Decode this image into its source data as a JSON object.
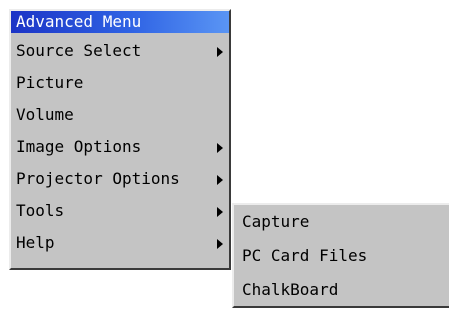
{
  "main_menu": {
    "title": "Advanced Menu",
    "items": [
      {
        "label": "Source Select",
        "has_submenu": true
      },
      {
        "label": "Picture",
        "has_submenu": false
      },
      {
        "label": "Volume",
        "has_submenu": false
      },
      {
        "label": "Image Options",
        "has_submenu": true
      },
      {
        "label": "Projector Options",
        "has_submenu": true
      },
      {
        "label": "Tools",
        "has_submenu": true
      },
      {
        "label": "Help",
        "has_submenu": true
      }
    ]
  },
  "tools_submenu": {
    "items": [
      {
        "label": "Capture"
      },
      {
        "label": "PC Card Files"
      },
      {
        "label": "ChalkBoard"
      }
    ]
  },
  "colors": {
    "menu_background": "#c4c4c4",
    "title_gradient_start": "#1c34c6",
    "title_gradient_end": "#5a95f4",
    "title_text": "#ffffff"
  }
}
